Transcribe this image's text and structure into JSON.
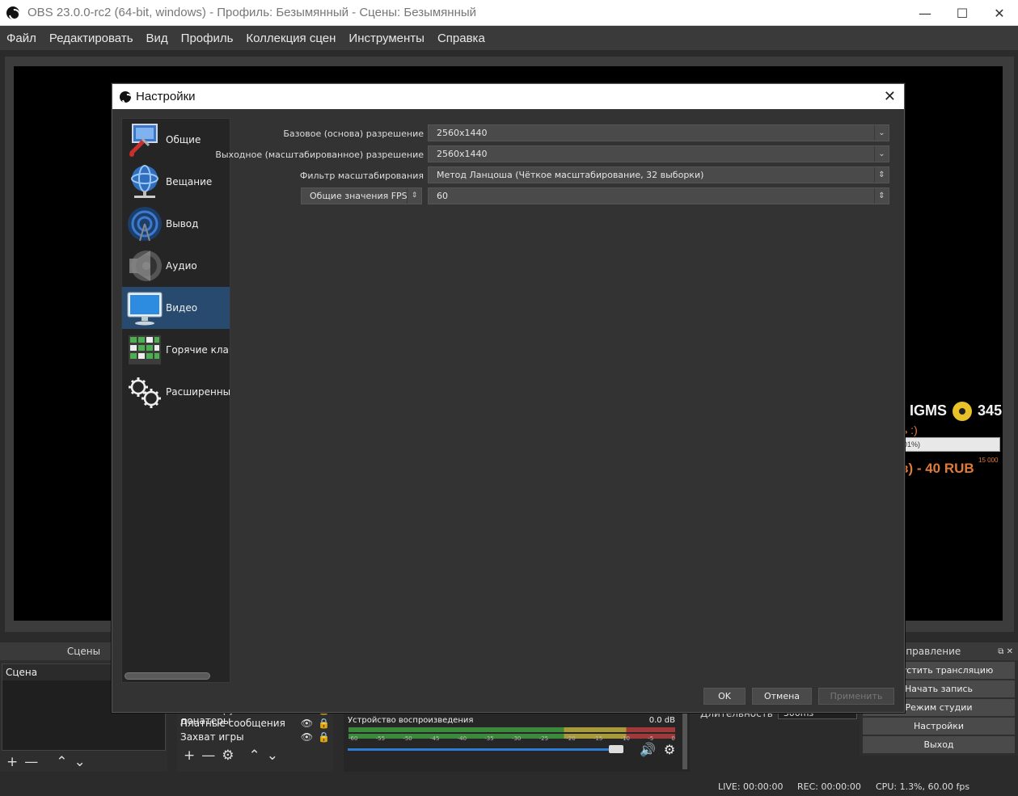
{
  "window": {
    "title": "OBS 23.0.0-rc2 (64-bit, windows) - Профиль: Безымянный - Сцены: Безымянный",
    "minimize": "—",
    "maximize": "☐",
    "close": "✕"
  },
  "menu": [
    "Файл",
    "Редактировать",
    "Вид",
    "Профиль",
    "Коллекция сцен",
    "Инструменты",
    "Справка"
  ],
  "overlay": {
    "line1_left": "ı IGMS",
    "line1_right": "345",
    "line2": "ь :)",
    "bar_text": "01%)",
    "goal": "15 000",
    "line4": "з) - 40 RUB"
  },
  "scenes": {
    "title": "Сцены",
    "items": [
      "Сцена"
    ],
    "toolbar": [
      "+",
      "—",
      "⌃",
      "⌄"
    ]
  },
  "sources": {
    "items": [
      {
        "label": "Самые крупные донатеры"
      },
      {
        "label": "Платные сообщения"
      },
      {
        "label": "Захват игры"
      }
    ],
    "toolbar": [
      "+",
      "—",
      "⚙",
      "⌃",
      "⌄"
    ]
  },
  "mixer": {
    "device": "Устройство воспроизведения",
    "db": "0.0 dB",
    "ticks": [
      "-60",
      "-55",
      "-50",
      "-45",
      "-40",
      "-35",
      "-30",
      "-25",
      "-20",
      "-15",
      "-10",
      "-5",
      "0"
    ],
    "volume_level": 0.96
  },
  "transitions": {
    "duration_label": "Длительность",
    "duration_value": "300ms"
  },
  "controls": {
    "title": "Управление",
    "buttons": [
      "Запустить трансляцию",
      "Начать запись",
      "Режим студии",
      "Настройки",
      "Выход"
    ]
  },
  "status": {
    "live": "LIVE: 00:00:00",
    "rec": "REC: 00:00:00",
    "cpu": "CPU: 1.3%, 60.00 fps"
  },
  "dialog": {
    "title": "Настройки",
    "close": "✕",
    "nav": [
      {
        "label": "Общие",
        "icon": "general-icon"
      },
      {
        "label": "Вещание",
        "icon": "stream-icon"
      },
      {
        "label": "Вывод",
        "icon": "output-icon"
      },
      {
        "label": "Аудио",
        "icon": "audio-icon"
      },
      {
        "label": "Видео",
        "icon": "video-icon",
        "active": true
      },
      {
        "label": "Горячие клавиши",
        "icon": "hotkeys-icon"
      },
      {
        "label": "Расширенные",
        "icon": "advanced-icon"
      }
    ],
    "fields": {
      "base_label": "Базовое (основа) разрешение",
      "base_value": "2560x1440",
      "output_label": "Выходное (масштабированное) разрешение",
      "output_value": "2560x1440",
      "filter_label": "Фильтр масштабирования",
      "filter_value": "Метод Ланцоша (Чёткое масштабирование, 32 выборки)",
      "fps_type": "Общие значения FPS",
      "fps_value": "60"
    },
    "buttons": {
      "ok": "OK",
      "cancel": "Отмена",
      "apply": "Применить"
    }
  },
  "colors": {
    "accent": "#274a6e",
    "slider": "#2c7bd4"
  }
}
